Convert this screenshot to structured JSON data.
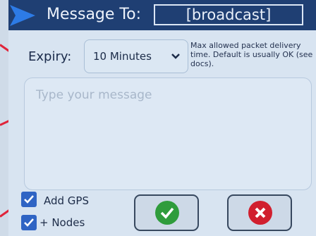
{
  "header": {
    "title": "Message To:",
    "recipient": "[broadcast]"
  },
  "expiry": {
    "label": "Expiry:",
    "selected": "10 Minutes",
    "help": "Max allowed packet delivery time. Default is usually OK (see docs)."
  },
  "message": {
    "placeholder": "Type your message"
  },
  "options": {
    "add_gps": {
      "label": "Add GPS",
      "checked": true
    },
    "plus_nodes": {
      "label": "+ Nodes",
      "checked": true
    }
  },
  "buttons": {
    "confirm": "confirm",
    "cancel": "cancel"
  },
  "colors": {
    "header_bg": "#1f3f73",
    "accent": "#2f64c4",
    "confirm": "#2f9c3c",
    "cancel": "#d11f2e"
  }
}
